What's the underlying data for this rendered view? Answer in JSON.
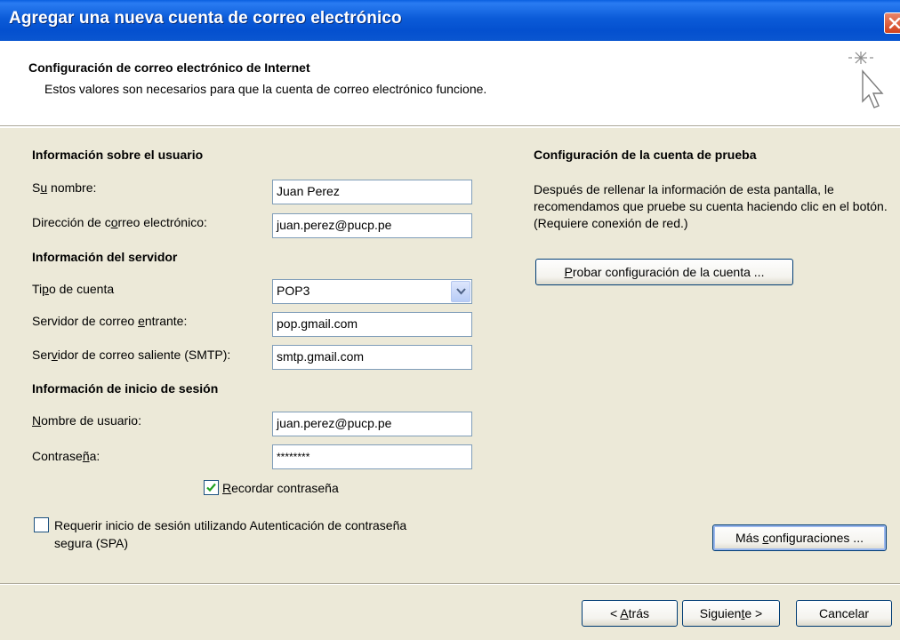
{
  "window": {
    "title": "Agregar una nueva cuenta de correo electrónico"
  },
  "header": {
    "title": "Configuración de correo electrónico de Internet",
    "subtitle": "Estos valores son necesarios para que la cuenta de correo electrónico funcione.",
    "icon": "wizard-cursor-icon"
  },
  "user_info": {
    "section_title": "Información sobre el usuario",
    "name_label_pre": "S",
    "name_label_key": "u",
    "name_label_post": " nombre:",
    "name_value": "Juan Perez",
    "email_label_pre": "Dirección de c",
    "email_label_key": "o",
    "email_label_post": "rreo electrónico:",
    "email_value": "juan.perez@pucp.pe"
  },
  "server_info": {
    "section_title": "Información del servidor",
    "account_type_label_pre": "Ti",
    "account_type_label_key": "p",
    "account_type_label_post": "o de cuenta",
    "account_type_value": "POP3",
    "incoming_label_pre": "Servidor de correo ",
    "incoming_label_key": "e",
    "incoming_label_post": "ntrante:",
    "incoming_value": "pop.gmail.com",
    "outgoing_label_pre": "Ser",
    "outgoing_label_key": "v",
    "outgoing_label_post": "idor de correo saliente (SMTP):",
    "outgoing_value": "smtp.gmail.com"
  },
  "login_info": {
    "section_title": "Información de inicio de sesión",
    "username_label_pre": "",
    "username_label_key": "N",
    "username_label_post": "ombre de usuario:",
    "username_value": "juan.perez@pucp.pe",
    "password_label_pre": "Contrase",
    "password_label_key": "ñ",
    "password_label_post": "a:",
    "password_value": "********",
    "remember_label_pre": "",
    "remember_label_key": "R",
    "remember_label_post": "ecordar contraseña",
    "remember_checked": true,
    "spa_label": "Requerir inicio de sesión utilizando Autenticación de contraseña segura (SPA)",
    "spa_checked": false
  },
  "test_settings": {
    "section_title": "Configuración de la cuenta de prueba",
    "description": "Después de rellenar la información de esta pantalla, le recomendamos que pruebe su cuenta haciendo clic en el botón. (Requiere conexión de red.)",
    "test_button_key": "P",
    "test_button_post": "robar configuración de la cuenta ...",
    "more_button_pre": "Más ",
    "more_button_key": "c",
    "more_button_post": "onfiguraciones ..."
  },
  "footer": {
    "back_pre": "< ",
    "back_key": "A",
    "back_post": "trás",
    "next_pre": "Siguien",
    "next_key": "t",
    "next_post": "e >",
    "cancel_label": "Cancelar"
  }
}
